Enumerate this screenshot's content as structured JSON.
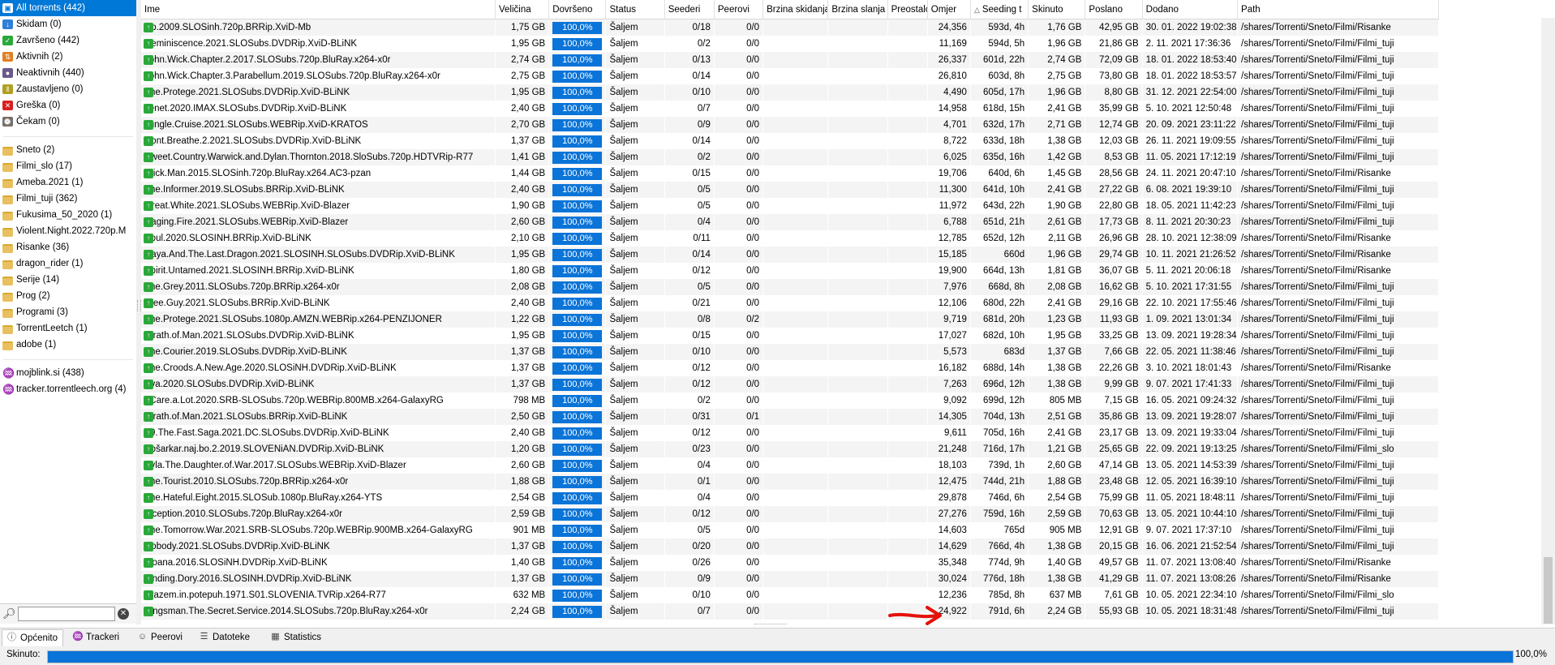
{
  "sidebar": {
    "status_filters": [
      {
        "label": "All torrents (442)",
        "icon": "all-torrents-icon",
        "color": "#0078d7",
        "selected": true
      },
      {
        "label": "Skidam (0)",
        "icon": "downloading-icon",
        "color": "#2f7fd6"
      },
      {
        "label": "Završeno (442)",
        "icon": "completed-icon",
        "color": "#2aa83a"
      },
      {
        "label": "Aktivnih (2)",
        "icon": "active-icon",
        "color": "#e08020"
      },
      {
        "label": "Neaktivnih (440)",
        "icon": "inactive-icon",
        "color": "#6a5a8a"
      },
      {
        "label": "Zaustavljeno (0)",
        "icon": "paused-icon",
        "color": "#b0a020"
      },
      {
        "label": "Greška (0)",
        "icon": "error-icon",
        "color": "#d82020"
      },
      {
        "label": "Čekam (0)",
        "icon": "queued-icon",
        "color": "#707070"
      }
    ],
    "categories": [
      {
        "label": "Sneto (2)"
      },
      {
        "label": "Filmi_slo (17)"
      },
      {
        "label": "Ameba.2021 (1)"
      },
      {
        "label": "Filmi_tuji (362)"
      },
      {
        "label": "Fukusima_50_2020 (1)"
      },
      {
        "label": "Violent.Night.2022.720p.M"
      },
      {
        "label": "Risanke (36)"
      },
      {
        "label": "dragon_rider (1)"
      },
      {
        "label": "Serije (14)"
      },
      {
        "label": "Prog (2)"
      },
      {
        "label": "Programi (3)"
      },
      {
        "label": "TorrentLeetch (1)"
      },
      {
        "label": "adobe (1)"
      }
    ],
    "trackers": [
      {
        "label": "mojblink.si (438)"
      },
      {
        "label": "tracker.torrentleech.org (4)"
      }
    ],
    "search": {
      "value": "",
      "placeholder": ""
    }
  },
  "columns": [
    "Ime",
    "Veličina",
    "Dovršeno",
    "Status",
    "Seederi",
    "Peerovi",
    "Brzina skidanja",
    "Brzina slanja",
    "Preostalo",
    "Omjer",
    "Seeding t",
    "Skinuto",
    "Poslano",
    "Dodano",
    "Path"
  ],
  "sorted_column": "Seeding t",
  "torrents": [
    {
      "name": "Up.2009.SLOSinh.720p.BRRip.XviD-Mb",
      "size": "1,75 GB",
      "done": "100,0%",
      "status": "Šaljem",
      "seeds": "0/18",
      "peers": "0/0",
      "ratio": "24,356",
      "seeding": "593d, 4h",
      "downloaded": "1,76 GB",
      "uploaded": "42,95 GB",
      "added": "30. 01. 2022 19:02:38",
      "path": "/shares/Torrenti/Sneto/Filmi/Risanke"
    },
    {
      "name": "Reminiscence.2021.SLOSubs.DVDRip.XviD-BLiNK",
      "size": "1,95 GB",
      "done": "100,0%",
      "status": "Šaljem",
      "seeds": "0/2",
      "peers": "0/0",
      "ratio": "11,169",
      "seeding": "594d, 5h",
      "downloaded": "1,96 GB",
      "uploaded": "21,86 GB",
      "added": "2. 11. 2021 17:36:36",
      "path": "/shares/Torrenti/Sneto/Filmi/Filmi_tuji"
    },
    {
      "name": "John.Wick.Chapter.2.2017.SLOSubs.720p.BluRay.x264-x0r",
      "size": "2,74 GB",
      "done": "100,0%",
      "status": "Šaljem",
      "seeds": "0/13",
      "peers": "0/0",
      "ratio": "26,337",
      "seeding": "601d, 22h",
      "downloaded": "2,74 GB",
      "uploaded": "72,09 GB",
      "added": "18. 01. 2022 18:53:40",
      "path": "/shares/Torrenti/Sneto/Filmi/Filmi_tuji"
    },
    {
      "name": "John.Wick.Chapter.3.Parabellum.2019.SLOSubs.720p.BluRay.x264-x0r",
      "size": "2,75 GB",
      "done": "100,0%",
      "status": "Šaljem",
      "seeds": "0/14",
      "peers": "0/0",
      "ratio": "26,810",
      "seeding": "603d, 8h",
      "downloaded": "2,75 GB",
      "uploaded": "73,80 GB",
      "added": "18. 01. 2022 18:53:57",
      "path": "/shares/Torrenti/Sneto/Filmi/Filmi_tuji"
    },
    {
      "name": "The.Protege.2021.SLOSubs.DVDRip.XviD-BLiNK",
      "size": "1,95 GB",
      "done": "100,0%",
      "status": "Šaljem",
      "seeds": "0/10",
      "peers": "0/0",
      "ratio": "4,490",
      "seeding": "605d, 17h",
      "downloaded": "1,96 GB",
      "uploaded": "8,80 GB",
      "added": "31. 12. 2021 22:54:00",
      "path": "/shares/Torrenti/Sneto/Filmi/Filmi_tuji"
    },
    {
      "name": "Tenet.2020.IMAX.SLOSubs.DVDRip.XviD-BLiNK",
      "size": "2,40 GB",
      "done": "100,0%",
      "status": "Šaljem",
      "seeds": "0/7",
      "peers": "0/0",
      "ratio": "14,958",
      "seeding": "618d, 15h",
      "downloaded": "2,41 GB",
      "uploaded": "35,99 GB",
      "added": "5. 10. 2021 12:50:48",
      "path": "/shares/Torrenti/Sneto/Filmi/Filmi_tuji"
    },
    {
      "name": "Jungle.Cruise.2021.SLOSubs.WEBRip.XviD-KRATOS",
      "size": "2,70 GB",
      "done": "100,0%",
      "status": "Šaljem",
      "seeds": "0/9",
      "peers": "0/0",
      "ratio": "4,701",
      "seeding": "632d, 17h",
      "downloaded": "2,71 GB",
      "uploaded": "12,74 GB",
      "added": "20. 09. 2021 23:11:22",
      "path": "/shares/Torrenti/Sneto/Filmi/Filmi_tuji"
    },
    {
      "name": "Dont.Breathe.2.2021.SLOSubs.DVDRip.XviD-BLiNK",
      "size": "1,37 GB",
      "done": "100,0%",
      "status": "Šaljem",
      "seeds": "0/14",
      "peers": "0/0",
      "ratio": "8,722",
      "seeding": "633d, 18h",
      "downloaded": "1,38 GB",
      "uploaded": "12,03 GB",
      "added": "26. 11. 2021 19:09:55",
      "path": "/shares/Torrenti/Sneto/Filmi/Filmi_tuji"
    },
    {
      "name": "Sweet.Country.Warwick.and.Dylan.Thornton.2018.SloSubs.720p.HDTVRip-R77",
      "size": "1,41 GB",
      "done": "100,0%",
      "status": "Šaljem",
      "seeds": "0/2",
      "peers": "0/0",
      "ratio": "6,025",
      "seeding": "635d, 16h",
      "downloaded": "1,42 GB",
      "uploaded": "8,53 GB",
      "added": "11. 05. 2021 17:12:19",
      "path": "/shares/Torrenti/Sneto/Filmi/Filmi_tuji"
    },
    {
      "name": "Stick.Man.2015.SLOSinh.720p.BluRay.x264.AC3-pzan",
      "size": "1,44 GB",
      "done": "100,0%",
      "status": "Šaljem",
      "seeds": "0/15",
      "peers": "0/0",
      "ratio": "19,706",
      "seeding": "640d, 6h",
      "downloaded": "1,45 GB",
      "uploaded": "28,56 GB",
      "added": "24. 11. 2021 20:47:10",
      "path": "/shares/Torrenti/Sneto/Filmi/Risanke"
    },
    {
      "name": "The.Informer.2019.SLOSubs.BRRip.XviD-BLiNK",
      "size": "2,40 GB",
      "done": "100,0%",
      "status": "Šaljem",
      "seeds": "0/5",
      "peers": "0/0",
      "ratio": "11,300",
      "seeding": "641d, 10h",
      "downloaded": "2,41 GB",
      "uploaded": "27,22 GB",
      "added": "6. 08. 2021 19:39:10",
      "path": "/shares/Torrenti/Sneto/Filmi/Filmi_tuji"
    },
    {
      "name": "Great.White.2021.SLOSubs.WEBRip.XviD-Blazer",
      "size": "1,90 GB",
      "done": "100,0%",
      "status": "Šaljem",
      "seeds": "0/5",
      "peers": "0/0",
      "ratio": "11,972",
      "seeding": "643d, 22h",
      "downloaded": "1,90 GB",
      "uploaded": "22,80 GB",
      "added": "18. 05. 2021 11:42:23",
      "path": "/shares/Torrenti/Sneto/Filmi/Filmi_tuji"
    },
    {
      "name": "Raging.Fire.2021.SLOSubs.WEBRip.XviD-Blazer",
      "size": "2,60 GB",
      "done": "100,0%",
      "status": "Šaljem",
      "seeds": "0/4",
      "peers": "0/0",
      "ratio": "6,788",
      "seeding": "651d, 21h",
      "downloaded": "2,61 GB",
      "uploaded": "17,73 GB",
      "added": "8. 11. 2021 20:30:23",
      "path": "/shares/Torrenti/Sneto/Filmi/Filmi_tuji"
    },
    {
      "name": "Soul.2020.SLOSINH.BRRip.XviD-BLiNK",
      "size": "2,10 GB",
      "done": "100,0%",
      "status": "Šaljem",
      "seeds": "0/11",
      "peers": "0/0",
      "ratio": "12,785",
      "seeding": "652d, 12h",
      "downloaded": "2,11 GB",
      "uploaded": "26,96 GB",
      "added": "28. 10. 2021 12:38:09",
      "path": "/shares/Torrenti/Sneto/Filmi/Risanke"
    },
    {
      "name": "Raya.And.The.Last.Dragon.2021.SLOSINH.SLOSubs.DVDRip.XviD-BLiNK",
      "size": "1,95 GB",
      "done": "100,0%",
      "status": "Šaljem",
      "seeds": "0/14",
      "peers": "0/0",
      "ratio": "15,185",
      "seeding": "660d",
      "downloaded": "1,96 GB",
      "uploaded": "29,74 GB",
      "added": "10. 11. 2021 21:26:52",
      "path": "/shares/Torrenti/Sneto/Filmi/Risanke"
    },
    {
      "name": "Spirit.Untamed.2021.SLOSINH.BRRip.XviD-BLiNK",
      "size": "1,80 GB",
      "done": "100,0%",
      "status": "Šaljem",
      "seeds": "0/12",
      "peers": "0/0",
      "ratio": "19,900",
      "seeding": "664d, 13h",
      "downloaded": "1,81 GB",
      "uploaded": "36,07 GB",
      "added": "5. 11. 2021 20:06:18",
      "path": "/shares/Torrenti/Sneto/Filmi/Risanke"
    },
    {
      "name": "The.Grey.2011.SLOSubs.720p.BRRip.x264-x0r",
      "size": "2,08 GB",
      "done": "100,0%",
      "status": "Šaljem",
      "seeds": "0/5",
      "peers": "0/0",
      "ratio": "7,976",
      "seeding": "668d, 8h",
      "downloaded": "2,08 GB",
      "uploaded": "16,62 GB",
      "added": "5. 10. 2021 17:31:55",
      "path": "/shares/Torrenti/Sneto/Filmi/Filmi_tuji"
    },
    {
      "name": "Free.Guy.2021.SLOSubs.BRRip.XviD-BLiNK",
      "size": "2,40 GB",
      "done": "100,0%",
      "status": "Šaljem",
      "seeds": "0/21",
      "peers": "0/0",
      "ratio": "12,106",
      "seeding": "680d, 22h",
      "downloaded": "2,41 GB",
      "uploaded": "29,16 GB",
      "added": "22. 10. 2021 17:55:46",
      "path": "/shares/Torrenti/Sneto/Filmi/Filmi_tuji"
    },
    {
      "name": "The.Protege.2021.SLOSubs.1080p.AMZN.WEBRip.x264-PENZIJONER",
      "size": "1,22 GB",
      "done": "100,0%",
      "status": "Šaljem",
      "seeds": "0/8",
      "peers": "0/2",
      "ratio": "9,719",
      "seeding": "681d, 20h",
      "downloaded": "1,23 GB",
      "uploaded": "11,93 GB",
      "added": "1. 09. 2021 13:01:34",
      "path": "/shares/Torrenti/Sneto/Filmi/Filmi_tuji"
    },
    {
      "name": "Wrath.of.Man.2021.SLOSubs.DVDRip.XviD-BLiNK",
      "size": "1,95 GB",
      "done": "100,0%",
      "status": "Šaljem",
      "seeds": "0/15",
      "peers": "0/0",
      "ratio": "17,027",
      "seeding": "682d, 10h",
      "downloaded": "1,95 GB",
      "uploaded": "33,25 GB",
      "added": "13. 09. 2021 19:28:34",
      "path": "/shares/Torrenti/Sneto/Filmi/Filmi_tuji"
    },
    {
      "name": "The.Courier.2019.SLOSubs.DVDRip.XviD-BLiNK",
      "size": "1,37 GB",
      "done": "100,0%",
      "status": "Šaljem",
      "seeds": "0/10",
      "peers": "0/0",
      "ratio": "5,573",
      "seeding": "683d",
      "downloaded": "1,37 GB",
      "uploaded": "7,66 GB",
      "added": "22. 05. 2021 11:38:46",
      "path": "/shares/Torrenti/Sneto/Filmi/Filmi_tuji"
    },
    {
      "name": "The.Croods.A.New.Age.2020.SLOSiNH.DVDRip.XviD-BLiNK",
      "size": "1,37 GB",
      "done": "100,0%",
      "status": "Šaljem",
      "seeds": "0/12",
      "peers": "0/0",
      "ratio": "16,182",
      "seeding": "688d, 14h",
      "downloaded": "1,38 GB",
      "uploaded": "22,26 GB",
      "added": "3. 10. 2021 18:01:43",
      "path": "/shares/Torrenti/Sneto/Filmi/Risanke"
    },
    {
      "name": "Ava.2020.SLOSubs.DVDRip.XviD-BLiNK",
      "size": "1,37 GB",
      "done": "100,0%",
      "status": "Šaljem",
      "seeds": "0/12",
      "peers": "0/0",
      "ratio": "7,263",
      "seeding": "696d, 12h",
      "downloaded": "1,38 GB",
      "uploaded": "9,99 GB",
      "added": "9. 07. 2021 17:41:33",
      "path": "/shares/Torrenti/Sneto/Filmi/Filmi_tuji"
    },
    {
      "name": "I.Care.a.Lot.2020.SRB-SLOSubs.720p.WEBRip.800MB.x264-GalaxyRG",
      "size": "798 MB",
      "done": "100,0%",
      "status": "Šaljem",
      "seeds": "0/2",
      "peers": "0/0",
      "ratio": "9,092",
      "seeding": "699d, 12h",
      "downloaded": "805 MB",
      "uploaded": "7,15 GB",
      "added": "16. 05. 2021 09:24:32",
      "path": "/shares/Torrenti/Sneto/Filmi/Filmi_tuji"
    },
    {
      "name": "Wrath.of.Man.2021.SLOSubs.BRRip.XviD-BLiNK",
      "size": "2,50 GB",
      "done": "100,0%",
      "status": "Šaljem",
      "seeds": "0/31",
      "peers": "0/1",
      "ratio": "14,305",
      "seeding": "704d, 13h",
      "downloaded": "2,51 GB",
      "uploaded": "35,86 GB",
      "added": "13. 09. 2021 19:28:07",
      "path": "/shares/Torrenti/Sneto/Filmi/Filmi_tuji"
    },
    {
      "name": "F9.The.Fast.Saga.2021.DC.SLOSubs.DVDRip.XviD-BLiNK",
      "size": "2,40 GB",
      "done": "100,0%",
      "status": "Šaljem",
      "seeds": "0/12",
      "peers": "0/0",
      "ratio": "9,611",
      "seeding": "705d, 16h",
      "downloaded": "2,41 GB",
      "uploaded": "23,17 GB",
      "added": "13. 09. 2021 19:33:04",
      "path": "/shares/Torrenti/Sneto/Filmi/Filmi_tuji"
    },
    {
      "name": "Košarkar.naj.bo.2.2019.SLOVENiAN.DVDRip.XviD-BLiNK",
      "size": "1,20 GB",
      "done": "100,0%",
      "status": "Šaljem",
      "seeds": "0/23",
      "peers": "0/0",
      "ratio": "21,248",
      "seeding": "716d, 17h",
      "downloaded": "1,21 GB",
      "uploaded": "25,65 GB",
      "added": "22. 09. 2021 19:13:25",
      "path": "/shares/Torrenti/Sneto/Filmi/Filmi_slo"
    },
    {
      "name": "Ayla.The.Daughter.of.War.2017.SLOSubs.WEBRip.XviD-Blazer",
      "size": "2,60 GB",
      "done": "100,0%",
      "status": "Šaljem",
      "seeds": "0/4",
      "peers": "0/0",
      "ratio": "18,103",
      "seeding": "739d, 1h",
      "downloaded": "2,60 GB",
      "uploaded": "47,14 GB",
      "added": "13. 05. 2021 14:53:39",
      "path": "/shares/Torrenti/Sneto/Filmi/Filmi_tuji"
    },
    {
      "name": "The.Tourist.2010.SLOSubs.720p.BRRip.x264-x0r",
      "size": "1,88 GB",
      "done": "100,0%",
      "status": "Šaljem",
      "seeds": "0/1",
      "peers": "0/0",
      "ratio": "12,475",
      "seeding": "744d, 21h",
      "downloaded": "1,88 GB",
      "uploaded": "23,48 GB",
      "added": "12. 05. 2021 16:39:10",
      "path": "/shares/Torrenti/Sneto/Filmi/Filmi_tuji"
    },
    {
      "name": "The.Hateful.Eight.2015.SLOSub.1080p.BluRay.x264-YTS",
      "size": "2,54 GB",
      "done": "100,0%",
      "status": "Šaljem",
      "seeds": "0/4",
      "peers": "0/0",
      "ratio": "29,878",
      "seeding": "746d, 6h",
      "downloaded": "2,54 GB",
      "uploaded": "75,99 GB",
      "added": "11. 05. 2021 18:48:11",
      "path": "/shares/Torrenti/Sneto/Filmi/Filmi_tuji"
    },
    {
      "name": "Inception.2010.SLOSubs.720p.BluRay.x264-x0r",
      "size": "2,59 GB",
      "done": "100,0%",
      "status": "Šaljem",
      "seeds": "0/12",
      "peers": "0/0",
      "ratio": "27,276",
      "seeding": "759d, 16h",
      "downloaded": "2,59 GB",
      "uploaded": "70,63 GB",
      "added": "13. 05. 2021 10:44:10",
      "path": "/shares/Torrenti/Sneto/Filmi/Filmi_tuji"
    },
    {
      "name": "The.Tomorrow.War.2021.SRB-SLOSubs.720p.WEBRip.900MB.x264-GalaxyRG",
      "size": "901 MB",
      "done": "100,0%",
      "status": "Šaljem",
      "seeds": "0/5",
      "peers": "0/0",
      "ratio": "14,603",
      "seeding": "765d",
      "downloaded": "905 MB",
      "uploaded": "12,91 GB",
      "added": "9. 07. 2021 17:37:10",
      "path": "/shares/Torrenti/Sneto/Filmi/Filmi_tuji"
    },
    {
      "name": "Nobody.2021.SLOSubs.DVDRip.XviD-BLiNK",
      "size": "1,37 GB",
      "done": "100,0%",
      "status": "Šaljem",
      "seeds": "0/20",
      "peers": "0/0",
      "ratio": "14,629",
      "seeding": "766d, 4h",
      "downloaded": "1,38 GB",
      "uploaded": "20,15 GB",
      "added": "16. 06. 2021 21:52:54",
      "path": "/shares/Torrenti/Sneto/Filmi/Filmi_tuji"
    },
    {
      "name": "Moana.2016.SLOSiNH.DVDRip.XviD-BLiNK",
      "size": "1,40 GB",
      "done": "100,0%",
      "status": "Šaljem",
      "seeds": "0/26",
      "peers": "0/0",
      "ratio": "35,348",
      "seeding": "774d, 9h",
      "downloaded": "1,40 GB",
      "uploaded": "49,57 GB",
      "added": "11. 07. 2021 13:08:40",
      "path": "/shares/Torrenti/Sneto/Filmi/Risanke"
    },
    {
      "name": "Finding.Dory.2016.SLOSINH.DVDRip.XviD-BLiNK",
      "size": "1,37 GB",
      "done": "100,0%",
      "status": "Šaljem",
      "seeds": "0/9",
      "peers": "0/0",
      "ratio": "30,024",
      "seeding": "776d, 18h",
      "downloaded": "1,38 GB",
      "uploaded": "41,29 GB",
      "added": "11. 07. 2021 13:08:26",
      "path": "/shares/Torrenti/Sneto/Filmi/Risanke"
    },
    {
      "name": "Erazem.in.potepuh.1971.S01.SLOVENIA.TVRip.x264-R77",
      "size": "632 MB",
      "done": "100,0%",
      "status": "Šaljem",
      "seeds": "0/10",
      "peers": "0/0",
      "ratio": "12,236",
      "seeding": "785d, 8h",
      "downloaded": "637 MB",
      "uploaded": "7,61 GB",
      "added": "10. 05. 2021 22:34:10",
      "path": "/shares/Torrenti/Sneto/Filmi/Filmi_slo"
    },
    {
      "name": "Kingsman.The.Secret.Service.2014.SLOSubs.720p.BluRay.x264-x0r",
      "size": "2,24 GB",
      "done": "100,0%",
      "status": "Šaljem",
      "seeds": "0/7",
      "peers": "0/0",
      "ratio": "24,922",
      "seeding": "791d, 6h",
      "downloaded": "2,24 GB",
      "uploaded": "55,93 GB",
      "added": "10. 05. 2021 18:31:48",
      "path": "/shares/Torrenti/Sneto/Filmi/Filmi_tuji"
    }
  ],
  "tabs": [
    {
      "label": "Općenito",
      "icon": "info-icon",
      "active": true
    },
    {
      "label": "Trackeri",
      "icon": "tracker-icon"
    },
    {
      "label": "Peerovi",
      "icon": "peers-icon"
    },
    {
      "label": "Datoteke",
      "icon": "files-icon"
    },
    {
      "label": "Statistics",
      "icon": "statistics-icon"
    }
  ],
  "status_bar": {
    "label": "Skinuto:",
    "progress": 1.0,
    "percent_text": "100,0%"
  },
  "colors": {
    "accent": "#0078d7",
    "progress": "#0a74d8",
    "download_icon": "#2aa83a",
    "annotation": "#e3120b"
  }
}
